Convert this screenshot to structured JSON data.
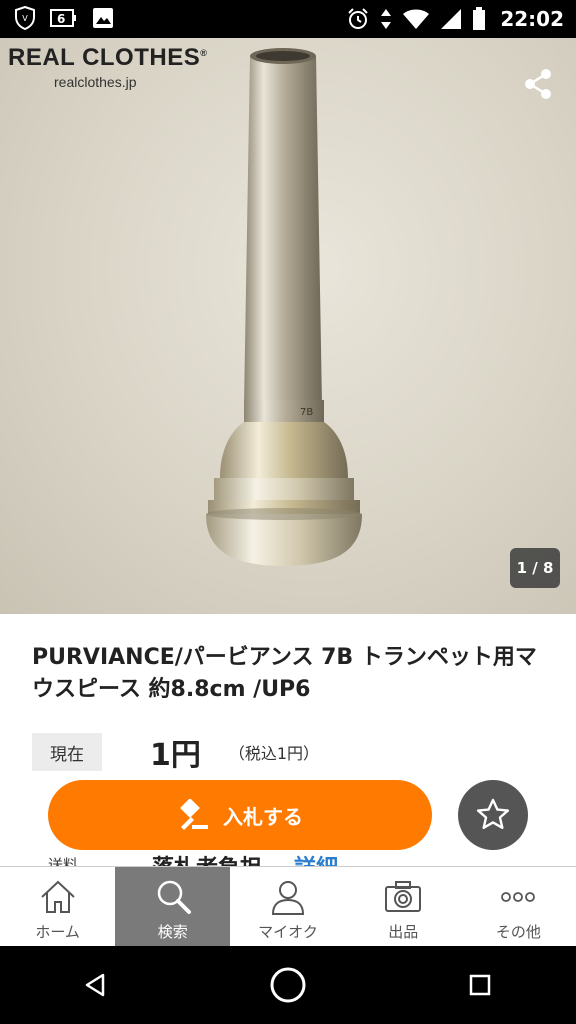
{
  "status_bar": {
    "time": "22:02"
  },
  "hero": {
    "brand_name": "REAL CLOTHES",
    "brand_mark": "®",
    "brand_site": "realclothes.jp",
    "image_counter": "1 / 8",
    "engraving": "7B"
  },
  "product": {
    "title": "PURVIANCE/パービアンス 7B トランペット用マウスピース 約8.8cm /UP6"
  },
  "price": {
    "tag": "現在",
    "value": "1円",
    "tax": "（税込1円）"
  },
  "actions": {
    "bid_label": "入札する"
  },
  "shipping": {
    "label": "送料",
    "value": "落札者負担",
    "link": "詳細"
  },
  "tabs": [
    {
      "label": "ホーム",
      "icon": "home-icon",
      "active": false
    },
    {
      "label": "検索",
      "icon": "search-icon",
      "active": true
    },
    {
      "label": "マイオク",
      "icon": "person-icon",
      "active": false
    },
    {
      "label": "出品",
      "icon": "camera-icon",
      "active": false
    },
    {
      "label": "その他",
      "icon": "more-icon",
      "active": false
    }
  ],
  "colors": {
    "accent": "#ff7a00",
    "link": "#2a7ccf",
    "active_tab": "#7a7a7a"
  }
}
